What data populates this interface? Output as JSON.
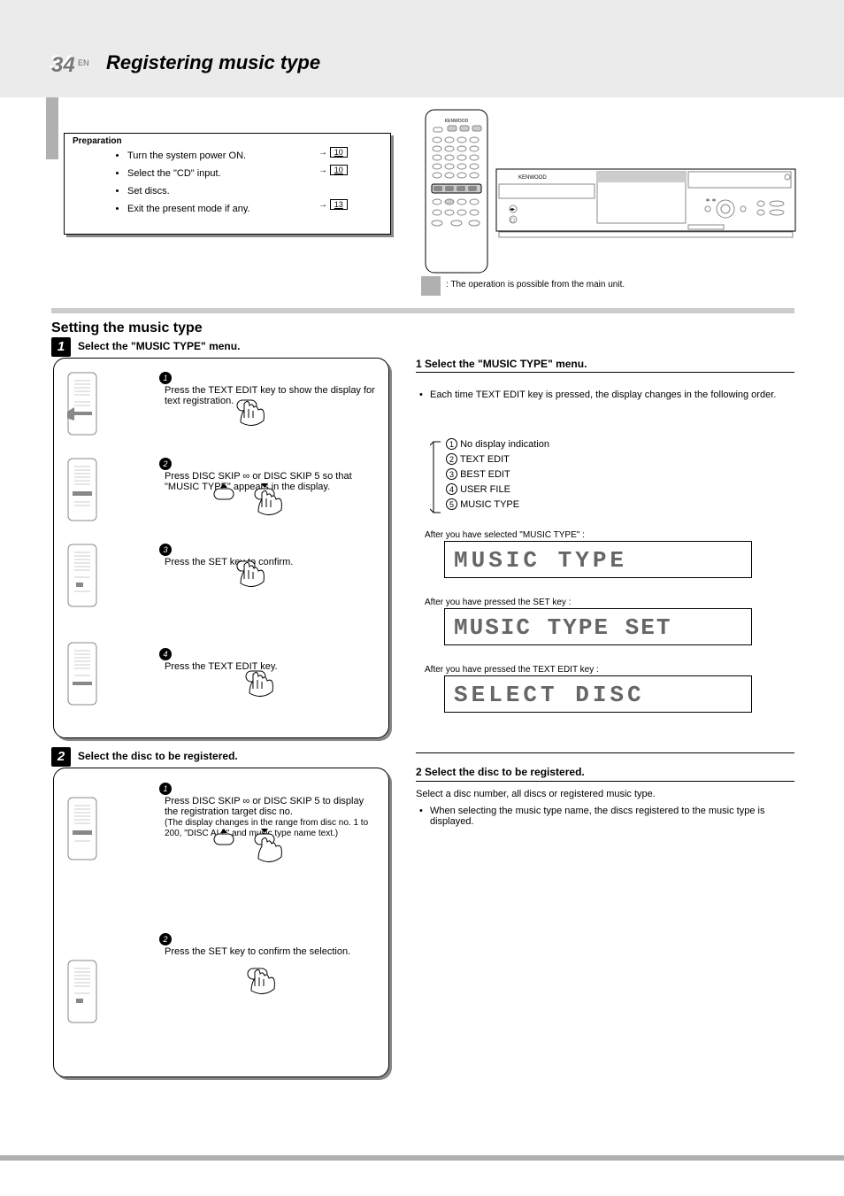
{
  "page_number": "34",
  "english_label": "EN",
  "page_title": "Registering music type",
  "prep": {
    "title": "Preparation",
    "items": [
      "Turn the system power ON.",
      "Select the \"CD\" input.",
      "Set discs.",
      "Exit the present mode if any."
    ],
    "refs": [
      "10",
      "10",
      "13"
    ]
  },
  "unit_hint": ": The operation is possible from the main unit.",
  "section1": "Setting the music type",
  "step1_label": "Select the \"MUSIC TYPE\" menu.",
  "box1": {
    "s1": "Press the TEXT EDIT key to show the display for text registration.",
    "s2": "Press DISC SKIP ∞ or DISC SKIP 5 so that \"MUSIC TYPE\" appears in the display.",
    "s3": "Press the SET key to confirm.",
    "s4": "Press the TEXT EDIT key."
  },
  "step2_label": "Select the disc to be registered.",
  "box2": {
    "s1": "Press DISC SKIP ∞ or DISC SKIP 5 to display the registration target disc no.",
    "s1_note": "(The display changes in the range from disc no. 1 to 200, \"DISC ALL\" and music type name text.)",
    "s2": "Press the SET key to confirm the selection."
  },
  "right": {
    "step1_head": "1 Select the \"MUSIC TYPE\" menu.",
    "step1_note": "Each time TEXT EDIT key is pressed, the display changes in the following order.",
    "order1": "No display indication",
    "order2": "TEXT EDIT",
    "order3": "BEST EDIT",
    "order4": "USER FILE",
    "order5": "MUSIC TYPE",
    "lcd1": "MUSIC TYPE",
    "lcd1_note": "After you have selected \"MUSIC TYPE\" :",
    "lcd2": "MUSIC TYPE SET",
    "lcd2_note": "After you have pressed the SET key :",
    "lcd3": "SELECT DISC",
    "lcd3_note": "After you have pressed the TEXT EDIT key :",
    "step2_head": "2 Select the disc to be registered.",
    "step2_text": "Select a disc number, all discs or registered music type.",
    "step2_note": "When selecting the music type name, the discs registered to the music type is displayed."
  }
}
